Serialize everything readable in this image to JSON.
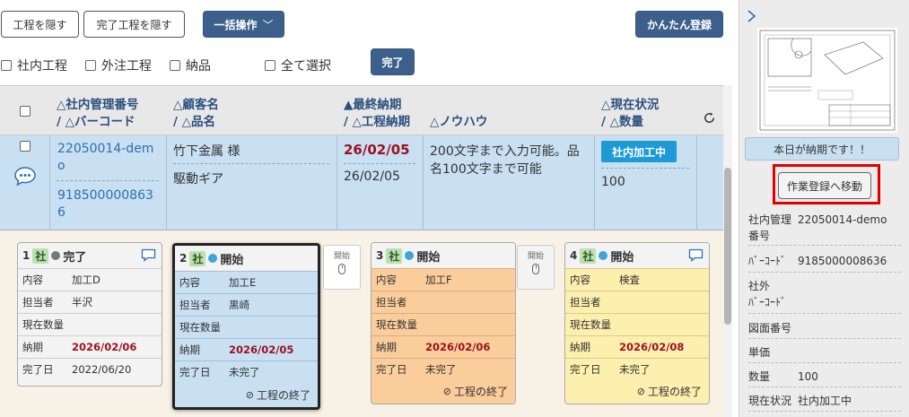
{
  "toolbar": {
    "hide_process": "工程を隠す",
    "hide_done": "完了工程を隠す",
    "bulk": "一括操作",
    "easy_register": "かんたん登録",
    "done": "完了"
  },
  "filters": {
    "internal": "社内工程",
    "external": "外注工程",
    "delivery": "納品",
    "select_all": "全て選択"
  },
  "headers": {
    "mgmt_no": "△社内管理番号",
    "barcode": "/ △バーコード",
    "customer": "△顧客名",
    "product": "/ △品名",
    "final_due": "▲最終納期",
    "process_due": "/ △工程納期",
    "knowhow": "△ノウハウ",
    "status": "△現在状況",
    "qty": "/ △数量"
  },
  "row": {
    "mgmt_no_1": "22050014-dem",
    "mgmt_no_2": "o",
    "barcode_1": "918500000863",
    "barcode_2": "6",
    "customer": "竹下金属 様",
    "product": "駆動ギア",
    "final_due": "26/02/05",
    "process_due": "26/02/05",
    "knowhow_1": "200文字まで入力可能。品",
    "knowhow_2": "名100文字まで可能",
    "status": "社内加工中",
    "qty": "100"
  },
  "cards": [
    {
      "num": "1",
      "sha": "社",
      "state": "完了",
      "dot": "#777777",
      "bg": "#f3f3f3",
      "hbg": "#f3f3f3",
      "content_k": "内容",
      "content_v": "加工D",
      "person_k": "担当者",
      "person_v": "半沢",
      "qty_k": "現在数量",
      "due_k": "納期",
      "due_v": "2026/02/06",
      "done_k": "完了日",
      "done_v": "2022/06/20"
    },
    {
      "num": "2",
      "sha": "社",
      "state": "開始",
      "dot": "#3aa6d9",
      "bg": "#c8e0f2",
      "hbg": "#f3f3f3",
      "content_k": "内容",
      "content_v": "加工E",
      "person_k": "担当者",
      "person_v": "黒崎",
      "qty_k": "現在数量",
      "due_k": "納期",
      "due_v": "2026/02/05",
      "done_k": "完了日",
      "done_v": "未完了",
      "end": "工程の終了"
    },
    {
      "num": "3",
      "sha": "社",
      "state": "開始",
      "dot": "#3aa6d9",
      "bg": "#fbcd9b",
      "hbg": "#f3f3f3",
      "content_k": "内容",
      "content_v": "加工F",
      "person_k": "担当者",
      "person_v": "",
      "qty_k": "現在数量",
      "due_k": "納期",
      "due_v": "2026/02/06",
      "done_k": "完了日",
      "done_v": "未完了",
      "end": "工程の終了"
    },
    {
      "num": "4",
      "sha": "社",
      "state": "開始",
      "dot": "#3aa6d9",
      "bg": "#fdefad",
      "hbg": "#f3f3f3",
      "content_k": "内容",
      "content_v": "検査",
      "person_k": "担当者",
      "person_v": "",
      "qty_k": "現在数量",
      "due_k": "納期",
      "due_v": "2026/02/08",
      "done_k": "完了日",
      "done_v": "未完了",
      "end": "工程の終了"
    }
  ],
  "start_label": "開始",
  "sidebar": {
    "due_notice": "本日が納期です！！",
    "goto_work": "作業登録へ移動",
    "mgmt_k1": "社内管理",
    "mgmt_k2": "番号",
    "mgmt_v": "22050014-demo",
    "barcode_k": "ﾊﾞｰｺｰﾄﾞ",
    "barcode_v": "9185000008636",
    "ext_k1": "社外",
    "ext_k2": "ﾊﾞｰｺｰﾄﾞ",
    "drawing_k": "図面番号",
    "price_k": "単価",
    "qty_k": "数量",
    "qty_v": "100",
    "status_k": "現在状況",
    "status_v": "社内加工中"
  },
  "colors": {
    "accent": "#3c5f8c",
    "status_badge": "#1e9ad6",
    "highlight": "#e00000"
  }
}
